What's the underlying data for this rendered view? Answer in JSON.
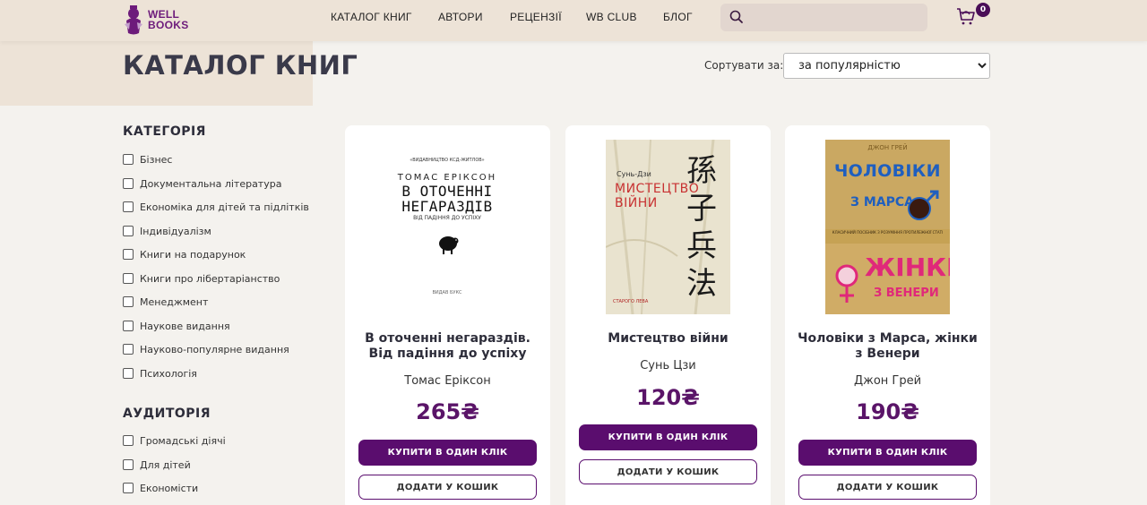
{
  "header": {
    "logo_line1": "WELL",
    "logo_line2": "BOOKS",
    "nav": [
      "КАТАЛОГ КНИГ",
      "АВТОРИ",
      "РЕЦЕНЗІЇ",
      "WB CLUB",
      "БЛОГ"
    ],
    "search_placeholder": "",
    "cart_count": "0",
    "brand_color": "#6d1b7b"
  },
  "page": {
    "title": "КАТАЛОГ КНИГ",
    "sort_label": "Сортувати за:",
    "sort_selected": "за популярністю"
  },
  "sidebar": {
    "category_title": "КАТЕГОРІЯ",
    "categories": [
      "Бізнес",
      "Документальна література",
      "Економіка для дітей та підлітків",
      "Індивідуалізм",
      "Книги на подарунок",
      "Книги про лібертаріанство",
      "Менеджмент",
      "Наукове видання",
      "Науково-популярне видання",
      "Психологія"
    ],
    "audience_title": "АУДИТОРІЯ",
    "audiences": [
      "Громадські діячі",
      "Для дітей",
      "Економісти"
    ]
  },
  "books": [
    {
      "title": "В оточенні негараздів. Від падіння до успіху",
      "author": "Томас Еріксон",
      "price": "265₴",
      "buy_label": "КУПИТИ В ОДИН КЛІК",
      "cart_label": "ДОДАТИ У КОШИК",
      "cover": {
        "publisher": "«ВИДАВНИЦТВО КСД-ЖИТЛОВ»",
        "author": "ТОМАС ЕРІКСОН",
        "title_line1": "В ОТОЧЕННІ",
        "title_line2": "НЕГАРАЗДІВ",
        "subtitle": "ВІД ПАДІННЯ ДО УСПІХУ",
        "logo": "ВИДАВ БУКС"
      }
    },
    {
      "title": "Мистецтво війни",
      "author": "Сунь Цзи",
      "price": "120₴",
      "buy_label": "КУПИТИ В ОДИН КЛІК",
      "cart_label": "ДОДАТИ У КОШИК",
      "cover": {
        "author": "Сунь-Дзи",
        "title_line1": "МИСТЕЦТВО",
        "title_line2": "ВІЙНИ",
        "chinese": "孫子兵法",
        "logo": "СТАРОГО ЛЕВА"
      }
    },
    {
      "title": "Чоловіки з Марса, жінки з Венери",
      "author": "Джон Грей",
      "price": "190₴",
      "buy_label": "КУПИТИ В ОДИН КЛІК",
      "cart_label": "ДОДАТИ У КОШИК",
      "cover": {
        "author": "ДЖОН ГРЕЙ",
        "line1": "ЧОЛОВІКИ",
        "line2": "З МАРСА",
        "band": "КЛАСИЧНИЙ ПОСІБНИК З РОЗУМІННЯ ПРОТИЛЕЖНОЇ СТАТІ",
        "line3": "ЖІНКИ",
        "line4": "З ВЕНЕРИ"
      }
    }
  ]
}
